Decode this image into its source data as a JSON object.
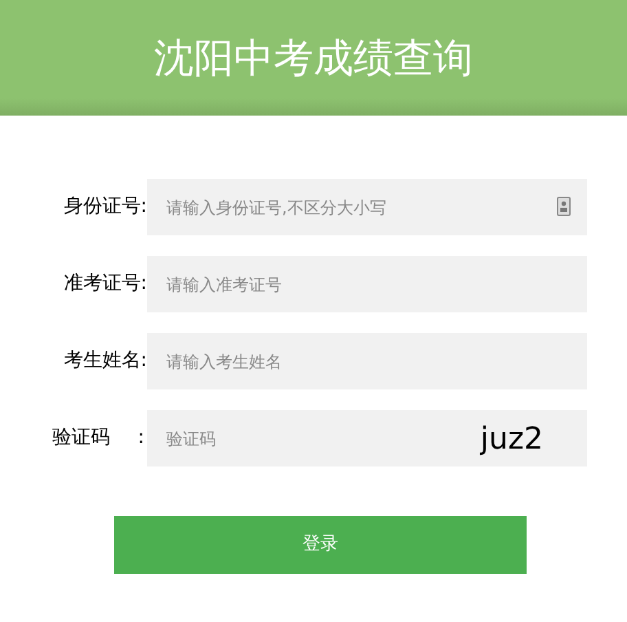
{
  "header": {
    "title": "沈阳中考成绩查询"
  },
  "fields": [
    {
      "kind": "text",
      "label": "身份证号:",
      "placeholder": "请输入身份证号,不区分大小写",
      "card_icon": true
    },
    {
      "kind": "text",
      "label": "准考证号:",
      "placeholder": "请输入准考证号"
    },
    {
      "kind": "text",
      "label": "考生姓名:",
      "placeholder": "请输入考生姓名"
    },
    {
      "kind": "captcha",
      "label": "验证码",
      "colon": ":",
      "placeholder": "验证码",
      "code": "juz2"
    }
  ],
  "submit": {
    "label": "登录"
  }
}
